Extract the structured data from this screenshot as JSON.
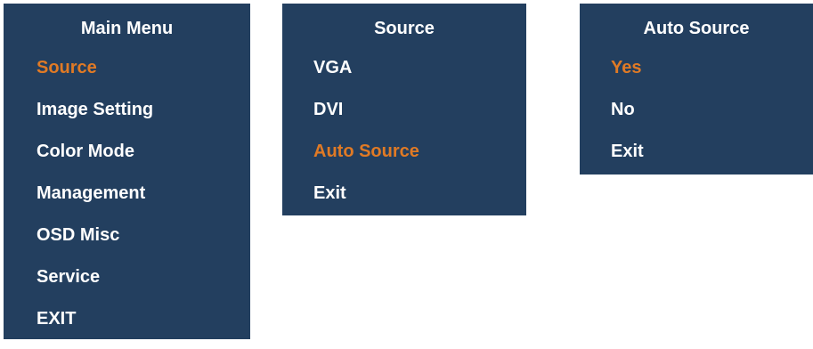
{
  "accent_color": "#e07a25",
  "panel_color": "#233f5f",
  "text_color": "#ffffff",
  "main_menu": {
    "title": "Main Menu",
    "items": [
      {
        "label": "Source",
        "selected": true
      },
      {
        "label": "Image Setting",
        "selected": false
      },
      {
        "label": "Color Mode",
        "selected": false
      },
      {
        "label": "Management",
        "selected": false
      },
      {
        "label": "OSD Misc",
        "selected": false
      },
      {
        "label": "Service",
        "selected": false
      },
      {
        "label": "EXIT",
        "selected": false
      }
    ]
  },
  "source_menu": {
    "title": "Source",
    "items": [
      {
        "label": "VGA",
        "selected": false
      },
      {
        "label": "DVI",
        "selected": false
      },
      {
        "label": "Auto Source",
        "selected": true
      },
      {
        "label": "Exit",
        "selected": false
      }
    ]
  },
  "auto_source_menu": {
    "title": "Auto Source",
    "items": [
      {
        "label": "Yes",
        "selected": true
      },
      {
        "label": "No",
        "selected": false
      },
      {
        "label": "Exit",
        "selected": false
      }
    ]
  }
}
